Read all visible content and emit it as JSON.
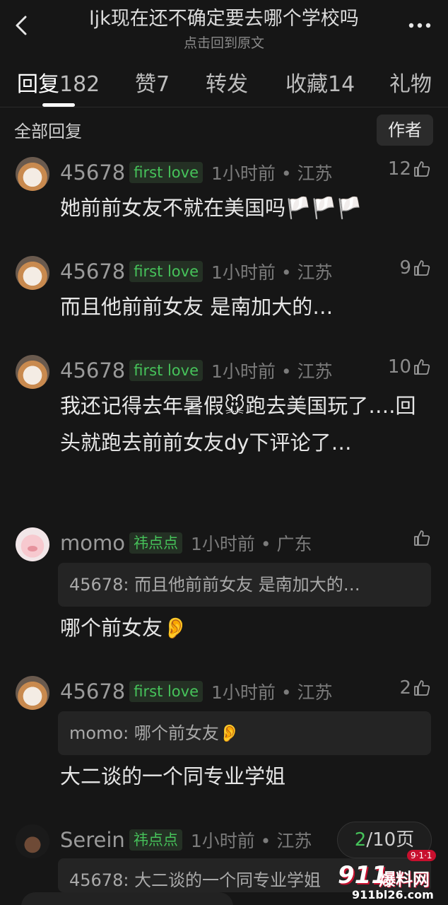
{
  "header": {
    "title": "ljk现在还不确定要去哪个学校吗",
    "subtitle": "点击回到原文"
  },
  "tabs": [
    {
      "label": "回复",
      "count": "182"
    },
    {
      "label": "赞",
      "count": "7"
    },
    {
      "label": "转发",
      "count": ""
    },
    {
      "label": "收藏",
      "count": "14"
    },
    {
      "label": "礼物",
      "count": ""
    }
  ],
  "section": {
    "all_replies": "全部回复",
    "author_filter": "作者"
  },
  "comments": [
    {
      "user": "45678",
      "tag": "first love",
      "time": "1小时前 • 江苏",
      "likes": "12",
      "text": "她前前女友不就在美国吗🏳️🏳️🏳️"
    },
    {
      "user": "45678",
      "tag": "first love",
      "time": "1小时前 • 江苏",
      "likes": "9",
      "text": "而且他前前女友 是南加大的…"
    },
    {
      "user": "45678",
      "tag": "first love",
      "time": "1小时前 • 江苏",
      "likes": "10",
      "text": "我还记得去年暑假🐭跑去美国玩了….回头就跑去前前女友dy下评论了…"
    },
    {
      "user": "momo",
      "tag": "祎点点",
      "time": "1小时前 • 广东",
      "likes": "",
      "quote": "45678: 而且他前前女友 是南加大的…",
      "text": "哪个前女友👂"
    },
    {
      "user": "45678",
      "tag": "first love",
      "time": "1小时前 • 江苏",
      "likes": "2",
      "quote": "momo: 哪个前女友👂",
      "text": "大二谈的一个同专业学姐"
    },
    {
      "user": "Serein",
      "tag": "祎点点",
      "time": "1小时前 • 江苏",
      "likes": "",
      "quote": "45678: 大二谈的一个同专业学姐"
    }
  ],
  "pager": {
    "current": "2",
    "rest": "/10页"
  },
  "watermark": {
    "num": "911",
    "cn": "爆料网",
    "url": "911bl26.com",
    "badge": "9·1·1"
  }
}
